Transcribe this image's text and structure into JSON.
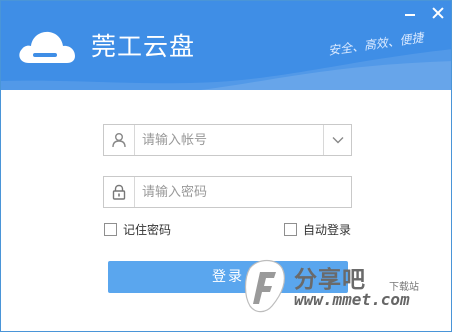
{
  "app": {
    "title": "莞工云盘",
    "slogan": "安全、高效、便捷"
  },
  "login": {
    "account_placeholder": "请输入帐号",
    "password_placeholder": "请输入密码",
    "remember_label": "记住密码",
    "auto_login_label": "自动登录",
    "login_button": "登录"
  },
  "watermark": {
    "name": "分享吧",
    "sub": "下载站",
    "url": "www.mmet.com"
  },
  "colors": {
    "header": "#3f8ee6",
    "button": "#5aa6ee",
    "border": "#c9c9c9"
  },
  "icons": [
    "cloud-logo-icon",
    "minimize-icon",
    "close-icon",
    "user-icon",
    "lock-icon",
    "chevron-down-icon"
  ]
}
